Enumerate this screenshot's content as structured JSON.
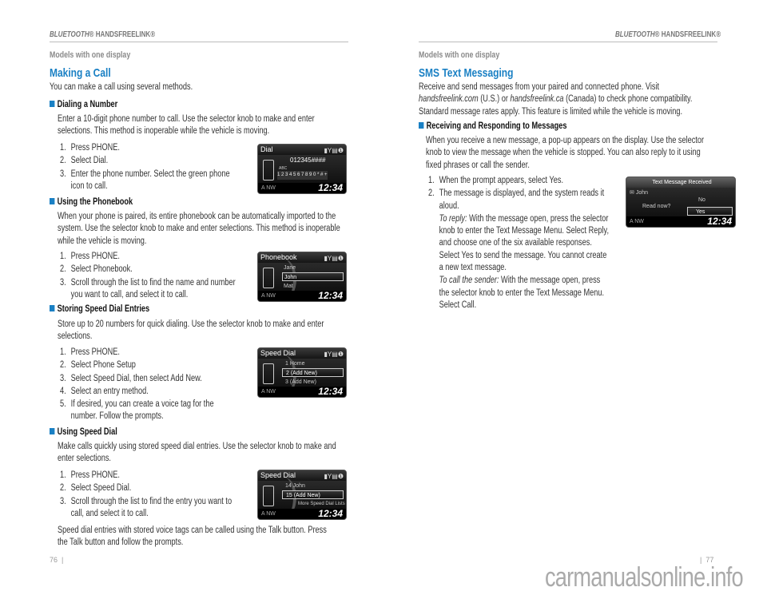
{
  "left": {
    "header": {
      "brand": "BLUETOOTH",
      "reg": "®",
      "product": "HANDSFREELINK®"
    },
    "models": "Models with one display",
    "title": "Making a Call",
    "intro": "You can make a call using several methods.",
    "sections": [
      {
        "heading": "Dialing a Number",
        "para": "Enter a 10-digit phone number to call. Use the selector knob to make and enter selections. This method is inoperable while the vehicle is moving.",
        "steps": [
          {
            "n": "1.",
            "t": "Press PHONE."
          },
          {
            "n": "2.",
            "t": "Select Dial."
          },
          {
            "n": "3.",
            "t": "Enter the phone number. Select the green phone icon to call."
          }
        ]
      },
      {
        "heading": "Using the Phonebook",
        "para": "When your phone is paired, its entire phonebook can be automatically imported to the system. Use the selector knob to make and enter selections. This method is inoperable while the vehicle is moving.",
        "steps": [
          {
            "n": "1.",
            "t": "Press PHONE."
          },
          {
            "n": "2.",
            "t": "Select Phonebook."
          },
          {
            "n": "3.",
            "t": "Scroll through the list to find the name and number you want to call, and select it to call."
          }
        ]
      },
      {
        "heading": "Storing Speed Dial Entries",
        "para": "Store up to 20 numbers for quick dialing. Use the selector knob to make and enter selections.",
        "steps": [
          {
            "n": "1.",
            "t": "Press PHONE."
          },
          {
            "n": "2.",
            "t": "Select Phone Setup"
          },
          {
            "n": "3.",
            "t": "Select Speed Dial, then select Add New."
          },
          {
            "n": "4.",
            "t": "Select an entry method."
          },
          {
            "n": "5.",
            "t": "If desired, you can create a voice tag for the number. Follow the prompts."
          }
        ]
      },
      {
        "heading": "Using Speed Dial",
        "para": "Make calls quickly using stored speed dial entries. Use the selector knob to make and enter selections.",
        "steps": [
          {
            "n": "1.",
            "t": "Press PHONE."
          },
          {
            "n": "2.",
            "t": "Select Speed Dial."
          },
          {
            "n": "3.",
            "t": "Scroll through the list to find the entry you want to call, and select it to call."
          }
        ]
      }
    ],
    "closing": "Speed dial entries with stored voice tags can be called using the Talk button. Press the Talk button and follow the prompts.",
    "page_number": "76"
  },
  "screens": {
    "heading_nw": "A NW",
    "clock": "12:34",
    "status_icons": "▮Y▤❶",
    "dial": {
      "title": "Dial",
      "number": "012345####",
      "abc": "ABC",
      "keys": "1 2 3 4 5 6 7 8 9 0 * # +"
    },
    "phonebook": {
      "title": "Phonebook",
      "items": [
        "Jane",
        "John",
        "Mat"
      ]
    },
    "speed1": {
      "title": "Speed Dial",
      "items": [
        "1  Home",
        "2    (Add New)",
        "3    (Add New)"
      ]
    },
    "speed2": {
      "title": "Speed Dial",
      "items": [
        "14  John",
        "15    (Add New)",
        "More Speed Dial Lists"
      ]
    },
    "sms": {
      "title": "Text Message Received",
      "sender": "John",
      "prompt": "Read now?",
      "no": "No",
      "yes": "Yes"
    }
  },
  "right": {
    "header": {
      "brand": "BLUETOOTH",
      "reg": "®",
      "product": "HANDSFREELINK®"
    },
    "models": "Models with one display",
    "title": "SMS Text Messaging",
    "intro": {
      "a": "Receive and send messages from your paired and connected phone. Visit ",
      "link1": "handsfreelink.com",
      "b": " (U.S.) or ",
      "link2": "handsfreelink.ca",
      "c": " (Canada) to check phone compatibility. Standard message rates apply. This feature is limited while the vehicle is moving."
    },
    "section": {
      "heading": "Receiving and Responding to Messages",
      "para": "When you receive a new message, a pop-up appears on the display. Use the selector knob to view the message when the vehicle is stopped. You can also reply to it using fixed phrases or call the sender.",
      "steps": [
        {
          "n": "1.",
          "t": "When the prompt appears, select Yes."
        },
        {
          "n": "2.",
          "t": "The message is displayed, and the system reads it aloud."
        }
      ],
      "reply_label": "To reply:",
      "reply_text": " With the message open, press the selector knob to enter the Text Message Menu. Select Reply, and choose one of the six available responses. Select Yes to send the message. You cannot create a new text message.",
      "call_label": "To call the sender:",
      "call_text": " With the message open, press the selector knob to enter the Text Message Menu. Select Call."
    },
    "page_number": "77"
  },
  "watermark": "carmanualsonline.info",
  "colors": {
    "accent": "#1a80c4"
  }
}
